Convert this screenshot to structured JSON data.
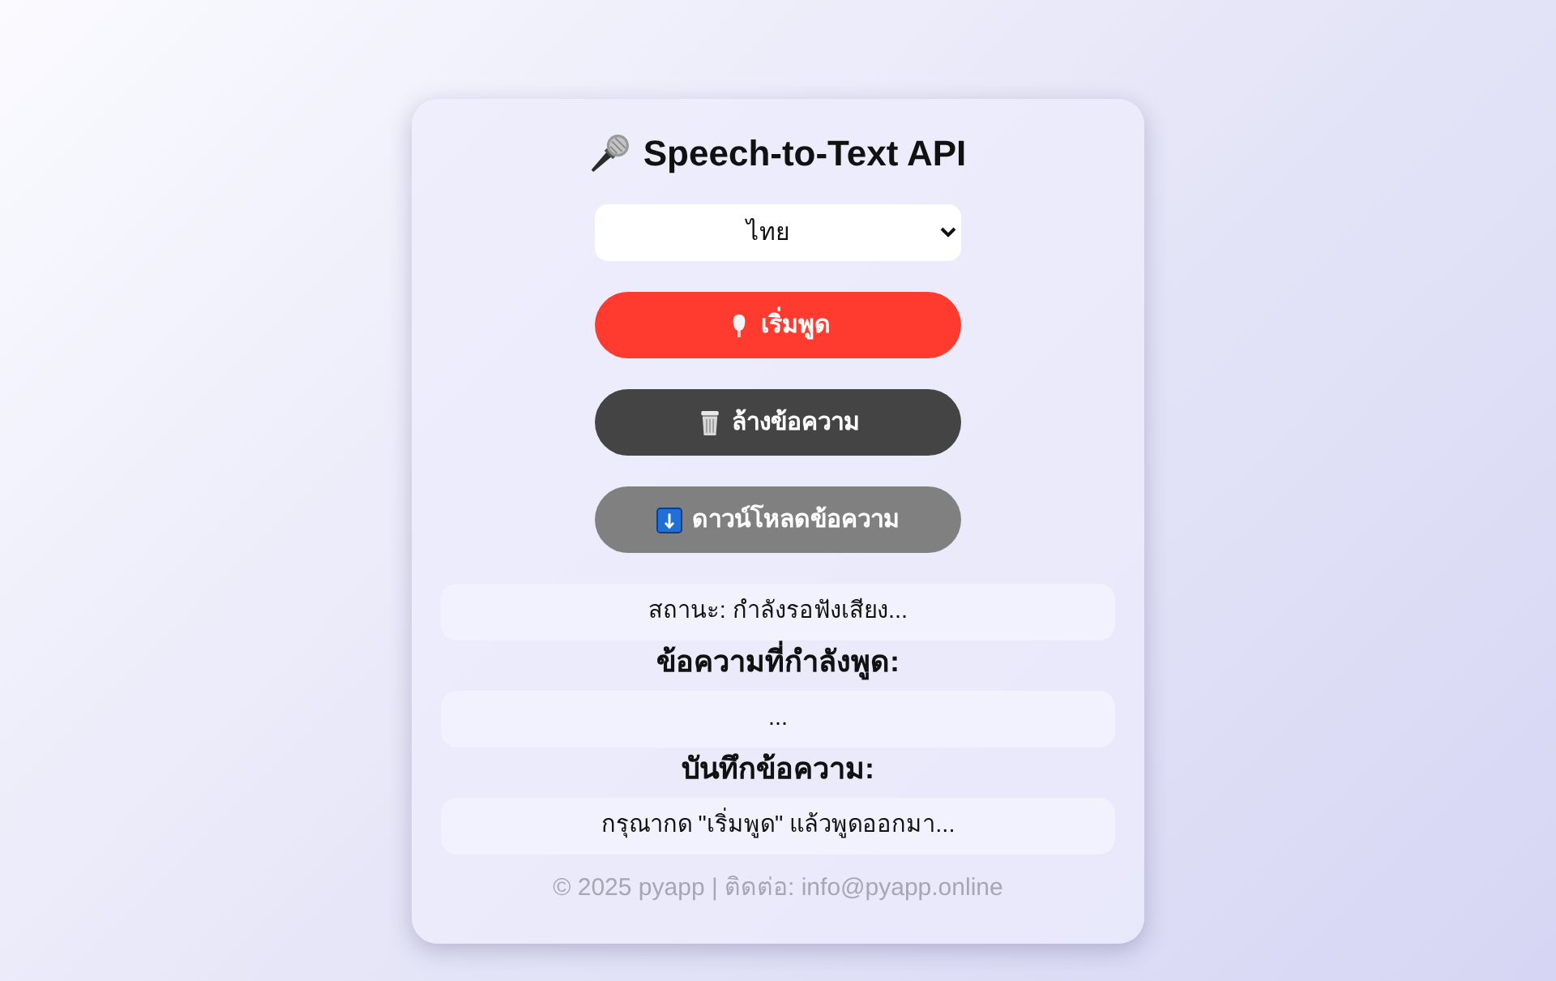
{
  "title": {
    "text": "Speech-to-Text API"
  },
  "language_select": {
    "value": "ไทย"
  },
  "buttons": [
    {
      "kind": "start",
      "label": "เริ่มพูด"
    },
    {
      "kind": "clear",
      "label": "ล้างข้อความ"
    },
    {
      "kind": "download",
      "label": "ดาวน์โหลดข้อความ"
    }
  ],
  "status": {
    "text": "สถานะ: กำลังรอฟังเสียง..."
  },
  "live": {
    "heading": "ข้อความที่กำลังพูด:",
    "text": "..."
  },
  "transcript": {
    "heading": "บันทึกข้อความ:",
    "text": "กรุณากด \"เริ่มพูด\" แล้วพูดออกมา..."
  },
  "footer": {
    "text": "© 2025 pyapp | ติดต่อ: info@pyapp.online"
  }
}
